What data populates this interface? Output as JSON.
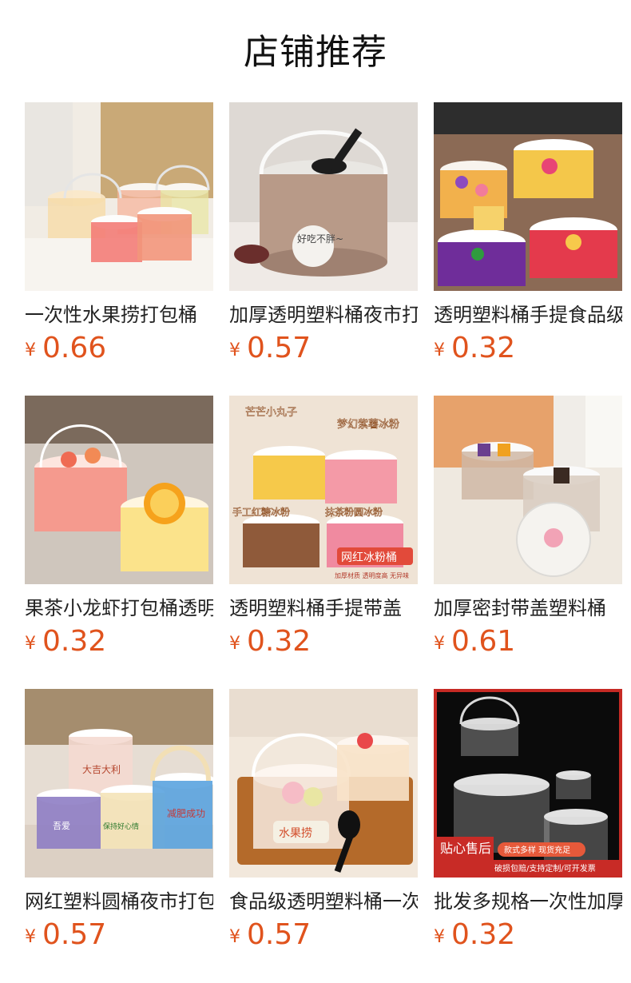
{
  "header": {
    "title": "店铺推荐"
  },
  "products": [
    {
      "name": "一次性水果捞打包桶",
      "currency": "¥",
      "price": "0.66"
    },
    {
      "name": "加厚透明塑料桶夜市打包",
      "currency": "¥",
      "price": "0.57"
    },
    {
      "name": "透明塑料桶手提食品级",
      "currency": "¥",
      "price": "0.32"
    },
    {
      "name": "果茶小龙虾打包桶透明",
      "currency": "¥",
      "price": "0.32"
    },
    {
      "name": "透明塑料桶手提带盖",
      "currency": "¥",
      "price": "0.32"
    },
    {
      "name": "加厚密封带盖塑料桶",
      "currency": "¥",
      "price": "0.61"
    },
    {
      "name": "网红塑料圆桶夜市打包",
      "currency": "¥",
      "price": "0.57"
    },
    {
      "name": "食品级透明塑料桶一次性",
      "currency": "¥",
      "price": "0.57"
    },
    {
      "name": "批发多规格一次性加厚",
      "currency": "¥",
      "price": "0.32"
    }
  ],
  "thumb_text": {
    "p2_label": "好吃不胖~",
    "p5_tag1": "芒芒小丸子",
    "p5_tag2": "梦幻紫薯冰粉",
    "p5_tag3": "手工红糖冰粉",
    "p5_tag4": "抹茶粉圆冰粉",
    "p5_banner": "网红冰粉桶",
    "p5_sub": "加厚材质 透明度高 无异味",
    "p7_label1": "大吉大利",
    "p7_label2": "保持好心情",
    "p7_label3": "减肥成功",
    "p7_label4": "吾爱",
    "p8_label": "水果捞",
    "p9_badge": "贴心售后",
    "p9_line1": "款式多样 现货充足",
    "p9_line2": "破损包赔/支持定制/可开发票"
  },
  "colors": {
    "price": "#e0531d",
    "title": "#111111",
    "name": "#222222"
  }
}
